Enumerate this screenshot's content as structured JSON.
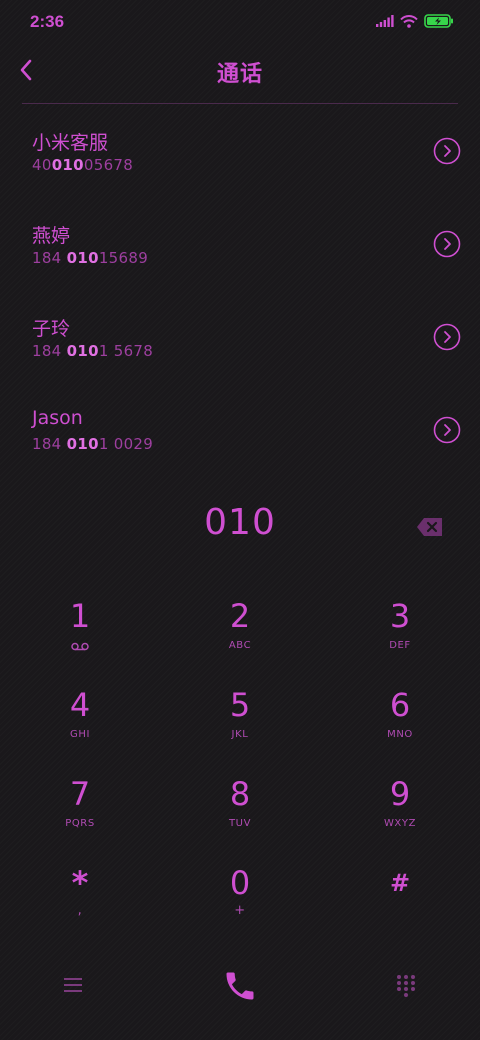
{
  "status": {
    "time": "2:36"
  },
  "header": {
    "title": "通话"
  },
  "contacts": [
    {
      "name": "小米客服",
      "number_pre": "40",
      "number_match": "010",
      "number_post": "05678"
    },
    {
      "name": "燕婷",
      "number_pre": "184 ",
      "number_match": "010",
      "number_post": "15689"
    },
    {
      "name": "子玲",
      "number_pre": "184 ",
      "number_match": "010",
      "number_post": "1 5678"
    },
    {
      "name": "Jason",
      "number_pre": "184 ",
      "number_match": "010",
      "number_post": "1 0029"
    }
  ],
  "dialer": {
    "input": "010"
  },
  "keypad": [
    {
      "digit": "1",
      "letters": "",
      "icon": "voicemail-icon"
    },
    {
      "digit": "2",
      "letters": "ABC"
    },
    {
      "digit": "3",
      "letters": "DEF"
    },
    {
      "digit": "4",
      "letters": "GHI"
    },
    {
      "digit": "5",
      "letters": "JKL"
    },
    {
      "digit": "6",
      "letters": "MNO"
    },
    {
      "digit": "7",
      "letters": "PQRS"
    },
    {
      "digit": "8",
      "letters": "TUV"
    },
    {
      "digit": "9",
      "letters": "WXYZ"
    },
    {
      "digit": "*",
      "letters": ","
    },
    {
      "digit": "0",
      "letters": "+"
    },
    {
      "digit": "#",
      "letters": ""
    }
  ],
  "icons": {
    "signal": "signal-icon",
    "wifi": "wifi-icon",
    "battery": "battery-charging-icon",
    "back": "chevron-left-icon",
    "detail": "chevron-right-circle-icon",
    "backspace": "backspace-icon",
    "menu": "menu-icon",
    "call": "phone-icon",
    "keypad": "dialpad-icon"
  },
  "colors": {
    "accent": "#cf4fd1",
    "accent_dim": "#9d3f9f",
    "background": "#1a181b",
    "battery": "#37d64b"
  }
}
